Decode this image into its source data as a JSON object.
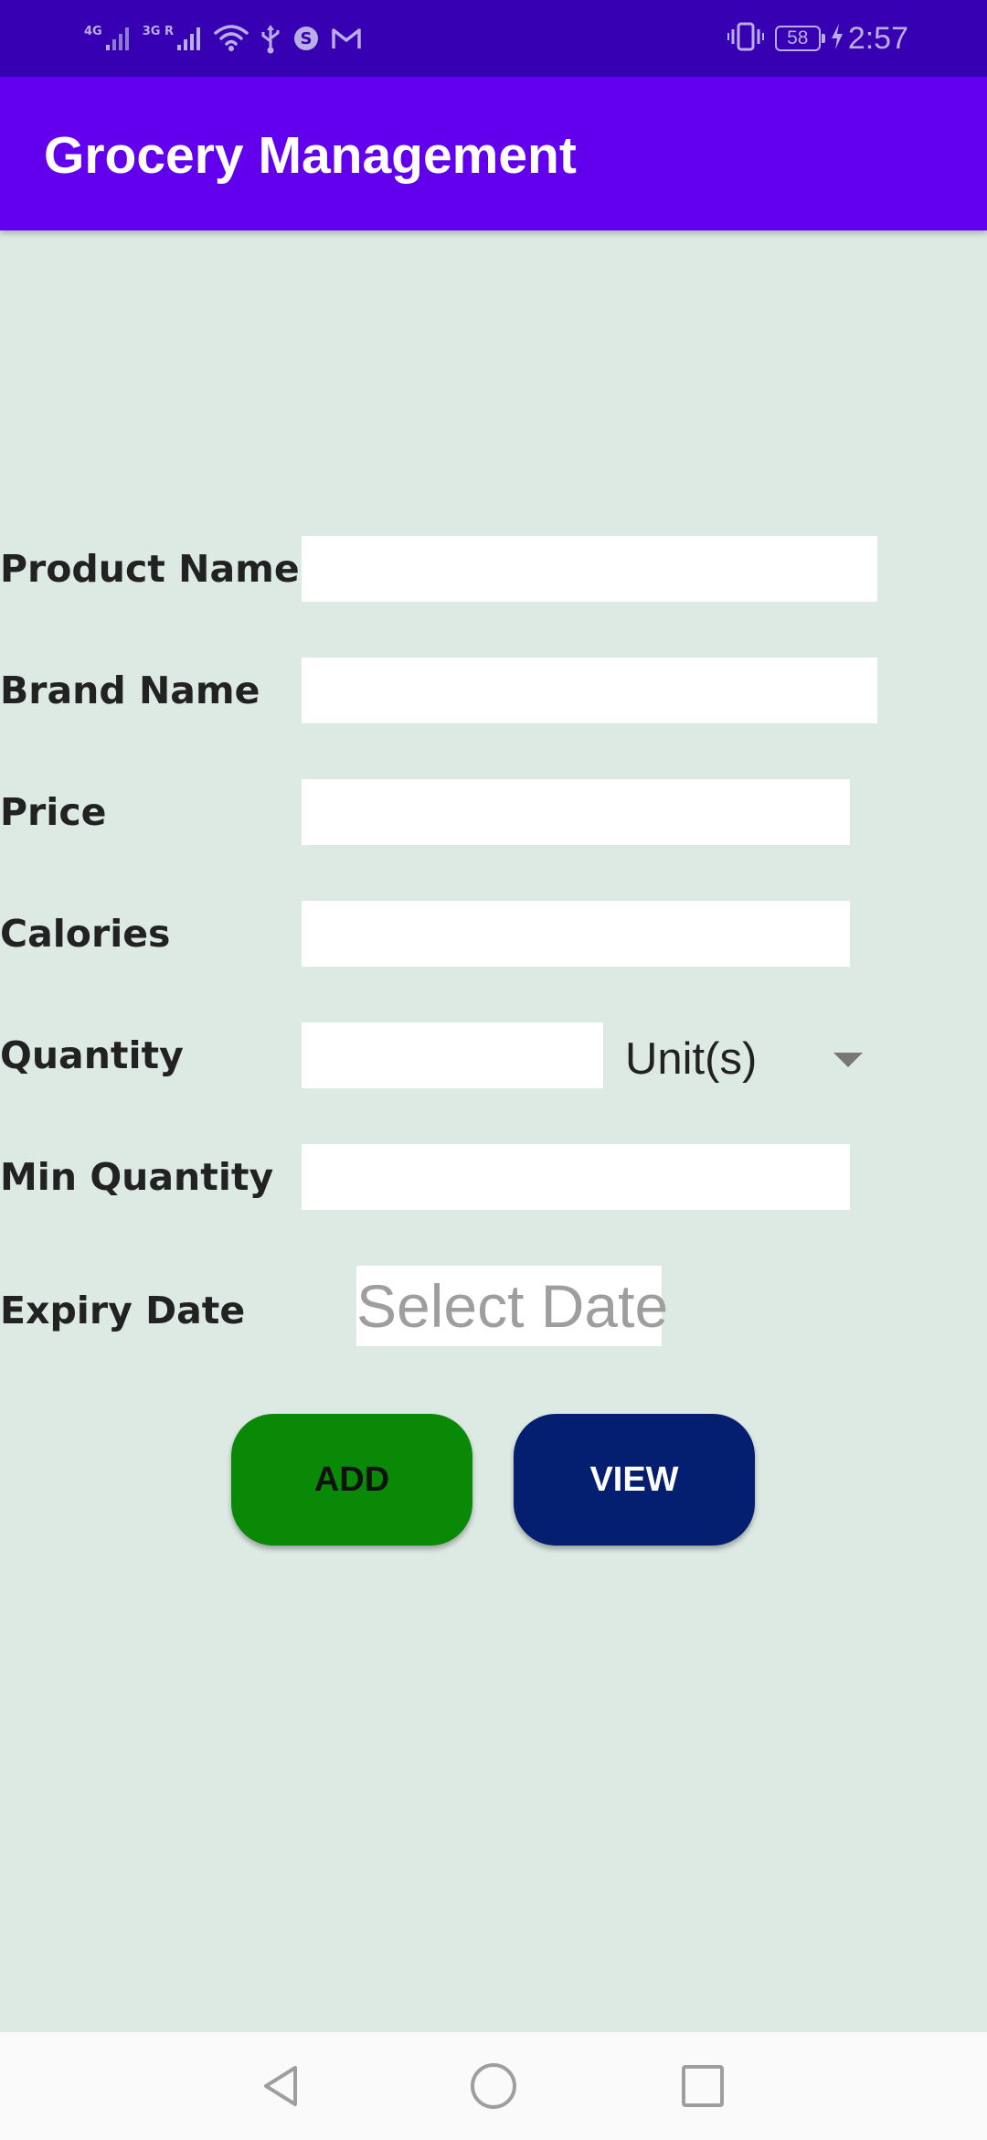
{
  "status_bar": {
    "network_1": "4G",
    "network_2": "3G R",
    "battery": "58",
    "time": "2:57",
    "colors": {
      "background": "#3700b3",
      "foreground": "#b9aee6"
    },
    "icons": [
      "signal-icon",
      "signal-icon",
      "wifi-icon",
      "usb-icon",
      "sync-icon",
      "gmail-icon",
      "vibrate-icon",
      "battery-icon",
      "charging-icon"
    ]
  },
  "app_bar": {
    "title": "Grocery Management",
    "color": "#6200ee"
  },
  "form": {
    "product_name": {
      "label": "Product Name",
      "value": ""
    },
    "brand_name": {
      "label": "Brand Name",
      "value": ""
    },
    "price": {
      "label": "Price",
      "value": ""
    },
    "calories": {
      "label": "Calories",
      "value": ""
    },
    "quantity": {
      "label": "Quantity",
      "value": "",
      "unit": "Unit(s)"
    },
    "min_quantity": {
      "label": "Min Quantity",
      "value": ""
    },
    "expiry_date": {
      "label": "Expiry Date",
      "placeholder": "Select Date"
    }
  },
  "buttons": {
    "add_label": "ADD",
    "view_label": "VIEW",
    "add_color": "#098905",
    "view_color": "#041f70"
  },
  "nav_bar": {
    "icons": [
      "back-icon",
      "home-icon",
      "recents-icon"
    ]
  }
}
